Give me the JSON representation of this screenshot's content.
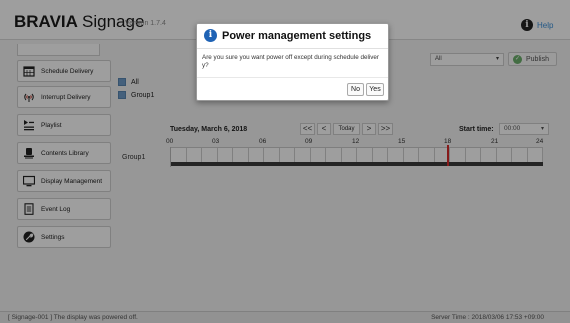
{
  "header": {
    "brand_bold": "BRAVIA",
    "brand_regular": "Signage",
    "version": "Version 1.7.4",
    "help_label": "Help"
  },
  "sidebar": {
    "items": [
      {
        "label": "Schedule Delivery",
        "icon": "calendar-icon"
      },
      {
        "label": "Interrupt Delivery",
        "icon": "broadcast-icon"
      },
      {
        "label": "Playlist",
        "icon": "playlist-icon"
      },
      {
        "label": "Contents Library",
        "icon": "library-icon"
      },
      {
        "label": "Display Management",
        "icon": "monitor-icon"
      },
      {
        "label": "Event Log",
        "icon": "document-icon"
      },
      {
        "label": "Settings",
        "icon": "wrench-icon"
      }
    ]
  },
  "groups": {
    "all_label": "All",
    "group1_label": "Group1"
  },
  "filter": {
    "selected": "All",
    "publish_label": "Publish"
  },
  "schedule": {
    "date": "Tuesday, March 6, 2018",
    "today_label": "Today",
    "first_label": "<<",
    "prev_label": "<",
    "next_label": ">",
    "last_label": ">>",
    "start_time_label": "Start time:",
    "start_time_value": "00:00",
    "hours": [
      "00",
      "03",
      "06",
      "09",
      "12",
      "15",
      "18",
      "21",
      "24"
    ],
    "row_label": "Group1",
    "current_time_fraction": 0.742
  },
  "footer": {
    "status": "[ Signage-001 ] The display was powered off.",
    "server_time": "Server Time : 2018/03/06 17:53 +09:00"
  },
  "dialog": {
    "title": "Power management settings",
    "message": "Are you sure you want power off except during schedule deliver y?",
    "no_label": "No",
    "yes_label": "Yes"
  },
  "colors": {
    "accent_blue": "#1f63b5",
    "current_time_marker": "#d82a2a",
    "publish_green": "#6cb06c",
    "checkbox_blue": "#6f9cc9"
  }
}
